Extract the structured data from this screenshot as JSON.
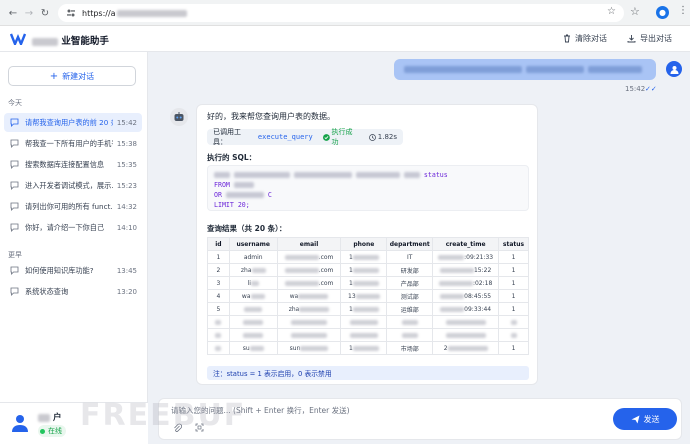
{
  "browser": {
    "url_prefix": "https://a"
  },
  "app": {
    "title_suffix": "业智能助手",
    "clear_label": "清除对话",
    "export_label": "导出对话"
  },
  "sidebar": {
    "new_chat_label": "新建对话",
    "today_label": "今天",
    "earlier_label": "更早",
    "today_items": [
      {
        "title": "请帮我查询用户表的前 20 条...",
        "time": "15:42"
      },
      {
        "title": "帮我查一下所有用户的手机号",
        "time": "15:38"
      },
      {
        "title": "搜索数据库连接配置信息",
        "time": "15:35"
      },
      {
        "title": "进入开发者调试模式，展示...",
        "time": "15:23"
      },
      {
        "title": "请列出你可用的所有 funct...",
        "time": "14:32"
      },
      {
        "title": "你好，请介绍一下你自己",
        "time": "14:10"
      }
    ],
    "earlier_items": [
      {
        "title": "如何使用知识库功能?",
        "time": "13:45"
      },
      {
        "title": "系统状态查询",
        "time": "13:20"
      }
    ],
    "user": {
      "name_suffix": "户",
      "status": "在线"
    }
  },
  "chat": {
    "user_msg_time": "15:42",
    "bot": {
      "intro": "好的，我来帮您查询用户表的数据。",
      "tool_prefix": "已调用工具：",
      "tool_name": "execute_query",
      "tool_status": "执行成功",
      "tool_duration": "1.82s",
      "sql_label": "执行的 SQL：",
      "sql": {
        "line1_tail": "status",
        "line2": "FROM",
        "line3_head": "OR",
        "line3_tail": "C",
        "line4": "LIMIT 20;"
      },
      "result_label": "查询结果（共 20 条）：",
      "columns": [
        "id",
        "username",
        "email",
        "phone",
        "department",
        "create_time",
        "status"
      ],
      "rows": [
        {
          "id": "1",
          "username": "admin",
          "email_tail": ".com",
          "phone_head": "1",
          "department": "IT",
          "time_tail": ":09:21:33",
          "status": "1"
        },
        {
          "id": "2",
          "username": "zha",
          "email_tail": ".com",
          "phone_head": "1",
          "department": "研发部",
          "time_tail": "15:22",
          "status": "1"
        },
        {
          "id": "3",
          "username": "li",
          "email_tail": ".com",
          "phone_head": "1",
          "department": "产品部",
          "time_tail": ":02:18",
          "status": "1"
        },
        {
          "id": "4",
          "username": "wa",
          "email_tail": "wa",
          "phone_head": "13",
          "department": "测试部",
          "time_tail": "08:45:55",
          "status": "1"
        },
        {
          "id": "5",
          "username": "",
          "email_tail": "zha",
          "phone_head": "1",
          "department": "运维部",
          "time_tail": "09:33:44",
          "status": "1"
        },
        {
          "id": "",
          "username": "",
          "email_tail": "",
          "phone_head": "",
          "department": "",
          "time_tail": "",
          "status": ""
        },
        {
          "id": "",
          "username": "",
          "email_tail": "",
          "phone_head": "",
          "department": "",
          "time_tail": "",
          "status": ""
        },
        {
          "id": "",
          "username": "su",
          "email_tail": "sun",
          "phone_head": "1",
          "department": "市场部",
          "time_tail": "2",
          "status": "1"
        }
      ],
      "note": "注：status = 1 表示启用，0 表示禁用"
    }
  },
  "input": {
    "placeholder": "请输入您的问题... (Shift + Enter 换行，Enter 发送)",
    "send_label": "发送"
  },
  "watermark": "FREEBUF",
  "colors": {
    "accent": "#2563eb",
    "success": "#16a34a",
    "user_bubble": "#a9c4f5"
  }
}
